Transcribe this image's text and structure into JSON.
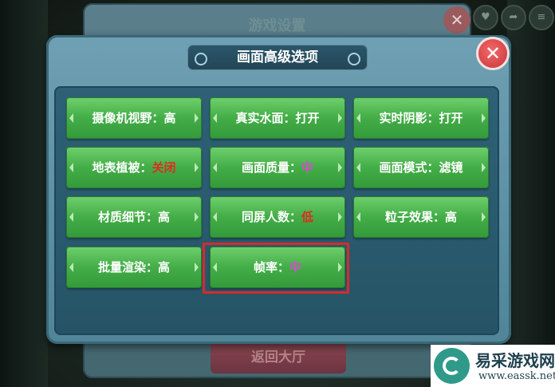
{
  "background": {
    "back_window_title": "游戏设置",
    "back_close_glyph": "✕",
    "return_hall_label": "返回大厅"
  },
  "panel": {
    "title": "画面高级选项",
    "close_glyph": "✕"
  },
  "options": [
    {
      "label": "摄像机视野：",
      "value": "高"
    },
    {
      "label": "真实水面：",
      "value": "打开"
    },
    {
      "label": "实时阴影：",
      "value": "打开"
    },
    {
      "label": "地表植被：",
      "value": "关闭",
      "value_color": "#e02b1f"
    },
    {
      "label": "画面质量：",
      "value": "中",
      "value_color": "#d94bd2"
    },
    {
      "label": "画面模式：",
      "value": "滤镜"
    },
    {
      "label": "材质细节：",
      "value": "高"
    },
    {
      "label": "同屏人数：",
      "value": "低",
      "value_color": "#e02b1f"
    },
    {
      "label": "粒子效果：",
      "value": "高"
    },
    {
      "label": "批量渲染：",
      "value": "高"
    },
    {
      "label": "帧率：",
      "value": "中",
      "value_color": "#d94bd2",
      "highlighted": true
    }
  ],
  "watermark": {
    "name": "易采游戏网",
    "url": "www.eassk.net"
  },
  "colors": {
    "button_green": "#43ad47",
    "panel_blue": "#5f93a6",
    "highlight_red": "#d62b2b"
  }
}
